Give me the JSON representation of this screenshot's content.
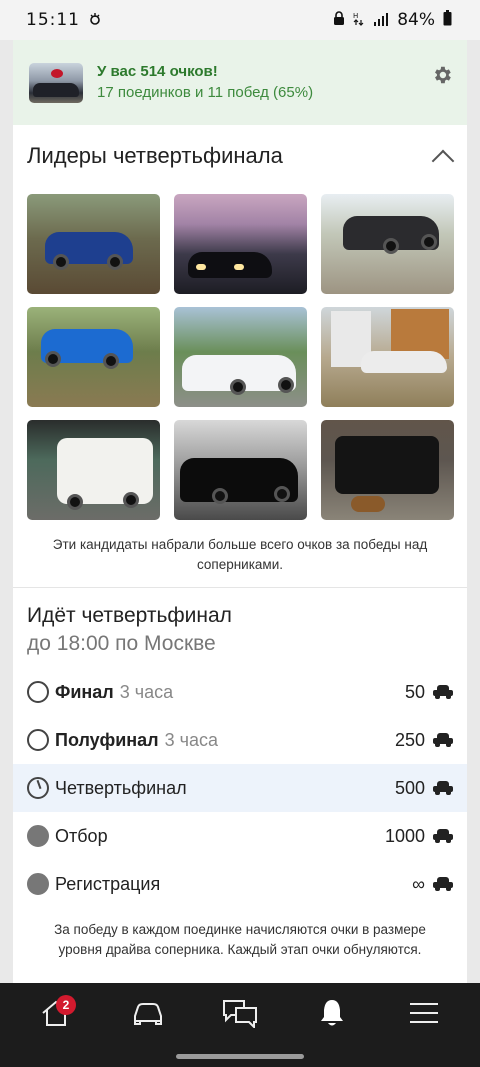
{
  "status_bar": {
    "time": "15:11",
    "battery": "84%",
    "left_icon": "notification-icon",
    "right_icons": [
      "lock-icon",
      "data-icon",
      "signal-icon",
      "battery-icon"
    ]
  },
  "score_banner": {
    "title": "У вас 514 очков!",
    "subtitle": "17 поединков и 11 побед (65%)",
    "settings_icon": "gear-icon"
  },
  "leaders": {
    "title": "Лидеры четвертьфинала",
    "toggle_icon": "chevron-up-icon",
    "photos": [
      "blue-sedan-photo",
      "dark-coupe-photo",
      "dark-sedan-photo",
      "blue-wagon-photo",
      "white-hatchback-photo",
      "white-sedan-photo",
      "white-van-photo",
      "black-coupe-photo",
      "black-suv-photo"
    ],
    "caption": "Эти кандидаты набрали больше всего очков за победы над соперниками."
  },
  "stage": {
    "title": "Идёт четвертьфинал",
    "subtitle": "до 18:00 по Москве",
    "rows": [
      {
        "name": "Финал",
        "duration": "3 часа",
        "points": "50",
        "state": "upcoming"
      },
      {
        "name": "Полуфинал",
        "duration": "3 часа",
        "points": "250",
        "state": "upcoming"
      },
      {
        "name": "Четвертьфинал",
        "duration": "",
        "points": "500",
        "state": "current"
      },
      {
        "name": "Отбор",
        "duration": "",
        "points": "1000",
        "state": "done"
      },
      {
        "name": "Регистрация",
        "duration": "",
        "points": "∞",
        "state": "done"
      }
    ],
    "caption": "За победу в каждом поединке начисляются очки в размере уровня драйва соперника. Каждый этап очки обнуляются."
  },
  "bottom_nav": {
    "items": [
      {
        "icon": "home-icon",
        "badge": "2"
      },
      {
        "icon": "car-icon"
      },
      {
        "icon": "messages-icon"
      },
      {
        "icon": "bell-icon"
      },
      {
        "icon": "menu-icon"
      }
    ]
  },
  "colors": {
    "banner_bg": "#e9f3e9",
    "banner_text": "#2d7a2d",
    "current_row_bg": "#edf3fb",
    "nav_bg": "#1c1c1c",
    "badge": "#d21a2e"
  }
}
